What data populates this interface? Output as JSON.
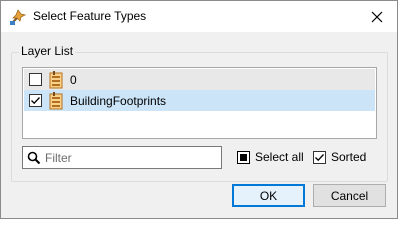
{
  "window": {
    "title": "Select Feature Types",
    "icon": "feature-types-icon",
    "close_icon": "close-icon"
  },
  "layer_list": {
    "label": "Layer List",
    "items": [
      {
        "label": "0",
        "checked": false,
        "icon": "feature-table-icon",
        "selected": false
      },
      {
        "label": "BuildingFootprints",
        "checked": true,
        "icon": "feature-table-icon",
        "selected": true
      }
    ]
  },
  "filter": {
    "placeholder": "Filter",
    "value": "",
    "icon": "search-icon"
  },
  "select_all": {
    "label": "Select all"
  },
  "sorted": {
    "label": "Sorted",
    "checked": true
  },
  "buttons": {
    "ok": "OK",
    "cancel": "Cancel"
  },
  "colors": {
    "selection": "#cce4f7",
    "accent": "#0078d7",
    "dialog_bg": "#f0f0f0"
  }
}
